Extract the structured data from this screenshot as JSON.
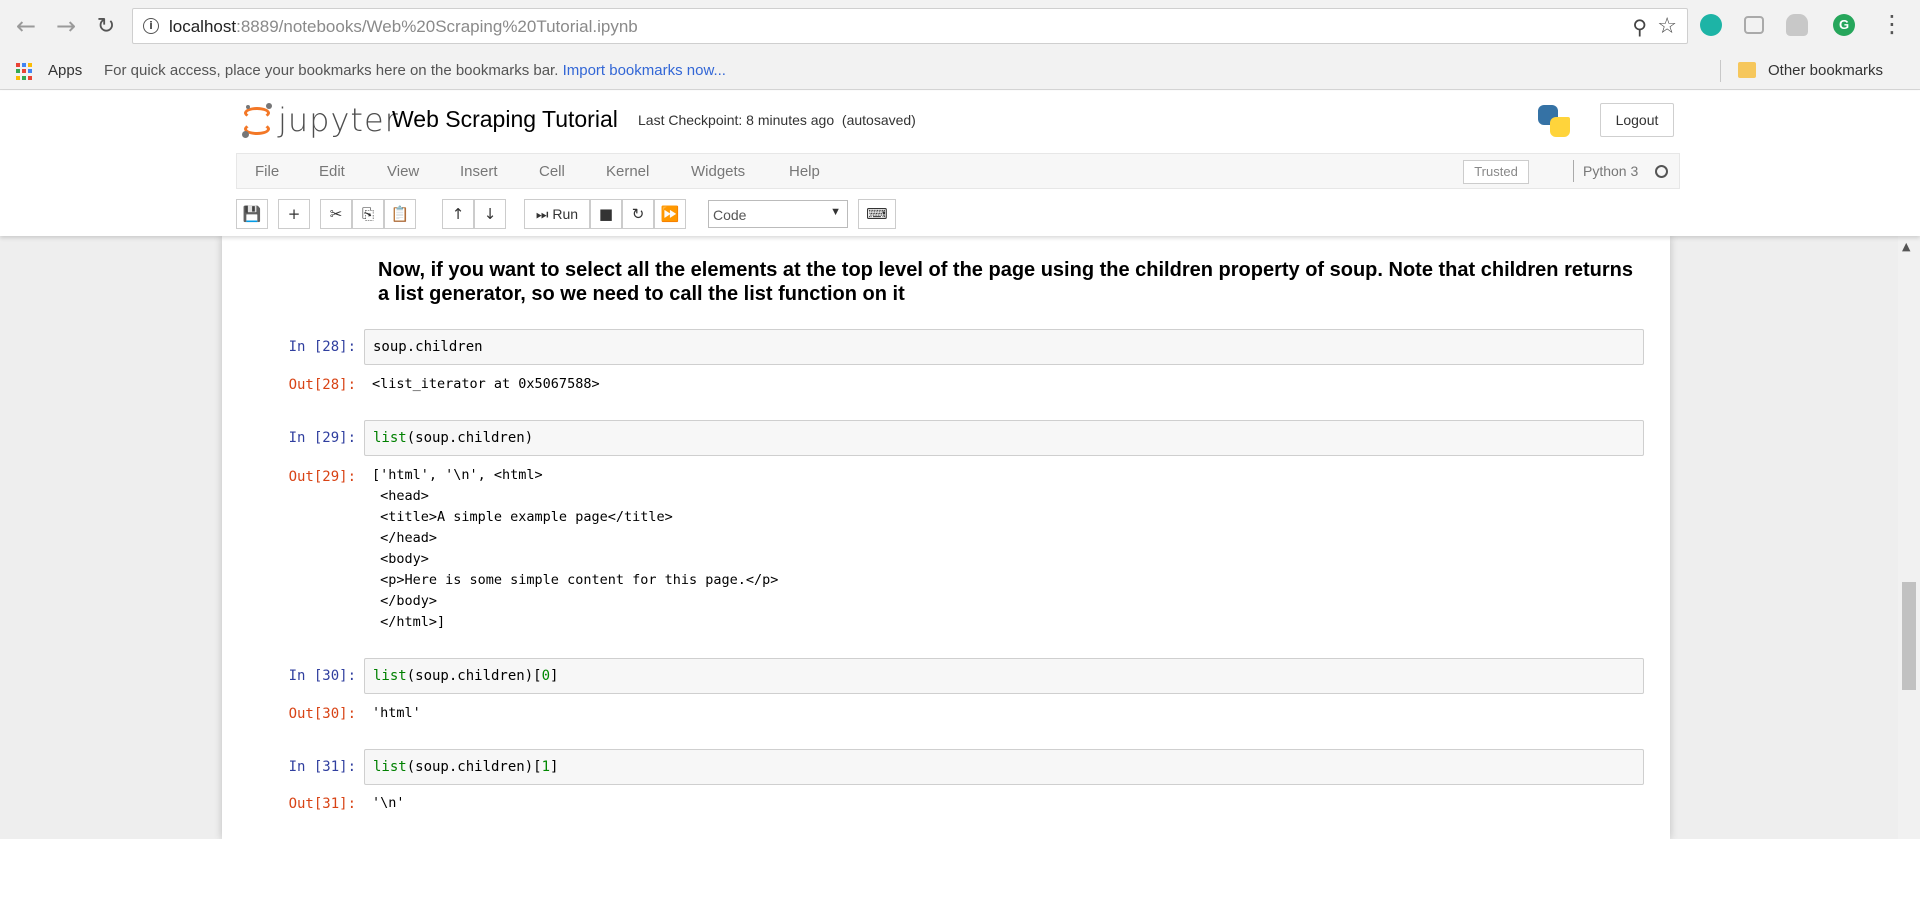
{
  "browser": {
    "nav_back": "←",
    "nav_forward": "→",
    "reload": "↻",
    "url_host": "localhost",
    "url_rest": ":8889/notebooks/Web%20Scraping%20Tutorial.ipynb",
    "zoom_icon": "⚲",
    "star_icon": "☆",
    "menu_icon": "⋮",
    "ext_grammarly_letter": "G"
  },
  "bookmarks": {
    "apps_label": "Apps",
    "hint": "For quick access, place your bookmarks here on the bookmarks bar.",
    "import_link": "Import bookmarks now...",
    "other": "Other bookmarks"
  },
  "jupyter": {
    "logo_text": "jupyter",
    "notebook_title": "Web Scraping Tutorial",
    "checkpoint": "Last Checkpoint: 8 minutes ago",
    "autosave": "(autosaved)",
    "logout": "Logout",
    "menu": [
      "File",
      "Edit",
      "View",
      "Insert",
      "Cell",
      "Kernel",
      "Widgets",
      "Help"
    ],
    "trusted": "Trusted",
    "kernel": "Python 3",
    "toolbar": {
      "save": "💾",
      "add": "+",
      "cut": "✂",
      "copy": "⎘",
      "paste": "📋",
      "up": "↑",
      "down": "↓",
      "run": "⏭ Run",
      "stop": "■",
      "restart": "↻",
      "fast_forward": "⏩",
      "cell_type": "Code",
      "cell_type_caret": "▼",
      "keyboard": "⌨"
    }
  },
  "notebook": {
    "markdown": "Now, if you want to select all the elements at the top level of the page using the children property of soup. Note that children returns a list generator, so we need to call the list function on it",
    "cells": [
      {
        "in_prompt": "In [28]:",
        "code": "soup.children",
        "out_prompt": "Out[28]:",
        "output": "<list_iterator at 0x5067588>"
      },
      {
        "in_prompt": "In [29]:",
        "code_kw": "list",
        "code_rest": "(soup.children)",
        "out_prompt": "Out[29]:",
        "output": "['html', '\\n', <html>\n <head>\n <title>A simple example page</title>\n </head>\n <body>\n <p>Here is some simple content for this page.</p>\n </body>\n </html>]"
      },
      {
        "in_prompt": "In [30]:",
        "code_kw": "list",
        "code_rest": "(soup.children)[",
        "code_num": "0",
        "code_end": "]",
        "out_prompt": "Out[30]:",
        "output": "'html'"
      },
      {
        "in_prompt": "In [31]:",
        "code_kw": "list",
        "code_rest": "(soup.children)[",
        "code_num": "1",
        "code_end": "]",
        "out_prompt": "Out[31]:",
        "output": "'\\n'"
      }
    ]
  },
  "colors": {
    "accent_orange": "#f37726",
    "prompt_in": "#303f9f",
    "prompt_out": "#d84315",
    "keyword_green": "#008000"
  }
}
